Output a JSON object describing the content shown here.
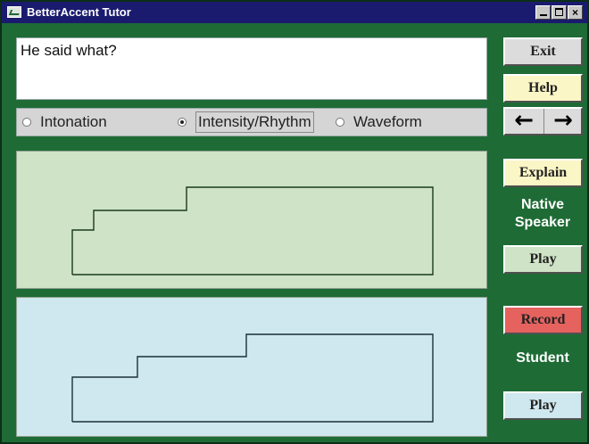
{
  "window": {
    "title": "BetterAccent Tutor",
    "minimize": "_",
    "maximize": "□",
    "close": "×"
  },
  "sentence": "He said what?",
  "modes": [
    {
      "label": "Intonation",
      "selected": false
    },
    {
      "label": "Intensity/Rhythm",
      "selected": true
    },
    {
      "label": "Waveform",
      "selected": false
    }
  ],
  "buttons": {
    "exit": "Exit",
    "help": "Help",
    "prev": "←",
    "next": "→",
    "explain": "Explain",
    "play_native": "Play",
    "record": "Record",
    "play_student": "Play"
  },
  "labels": {
    "native_line1": "Native",
    "native_line2": "Speaker",
    "student": "Student"
  },
  "colors": {
    "background": "#1e6b35",
    "native_panel": "#cfe3c6",
    "student_panel": "#cfe7ee",
    "record": "#e5625e",
    "highlight": "#fbf6c6"
  }
}
